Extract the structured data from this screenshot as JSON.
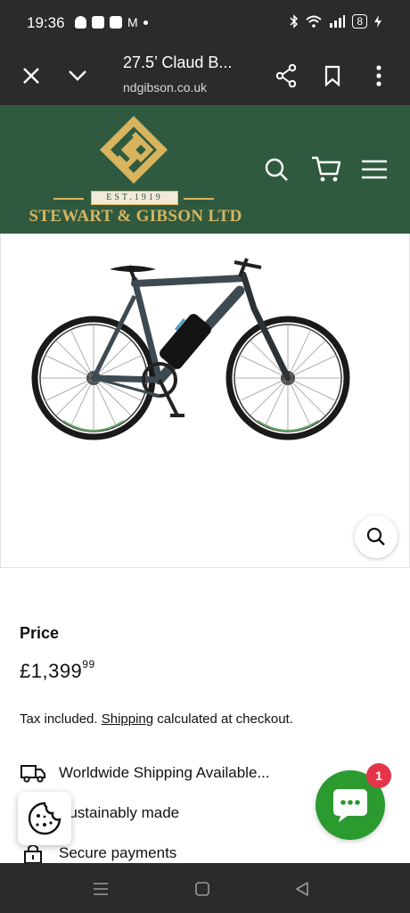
{
  "status_bar": {
    "time": "19:36",
    "battery": "8"
  },
  "browser": {
    "title": "27.5’ Claud B...",
    "url": "ndgibson.co.uk"
  },
  "site": {
    "est_text": "EST.1919",
    "brand_name": "STEWART & GIBSON LTD",
    "header_color": "#2f5a40",
    "accent_gold": "#d8b45e"
  },
  "product": {
    "price_label": "Price",
    "price_main": "£1,399",
    "price_cents": "99",
    "tax_prefix": "Tax included. ",
    "shipping_link": "Shipping",
    "tax_suffix": " calculated at checkout.",
    "features": [
      {
        "icon": "truck-icon",
        "label": "Worldwide Shipping Available..."
      },
      {
        "icon": "leaf-icon",
        "label": "Sustainably made"
      },
      {
        "icon": "lock-icon",
        "label": "Secure payments"
      }
    ]
  },
  "chat": {
    "badge_count": "1",
    "color": "#2b9a2f"
  }
}
